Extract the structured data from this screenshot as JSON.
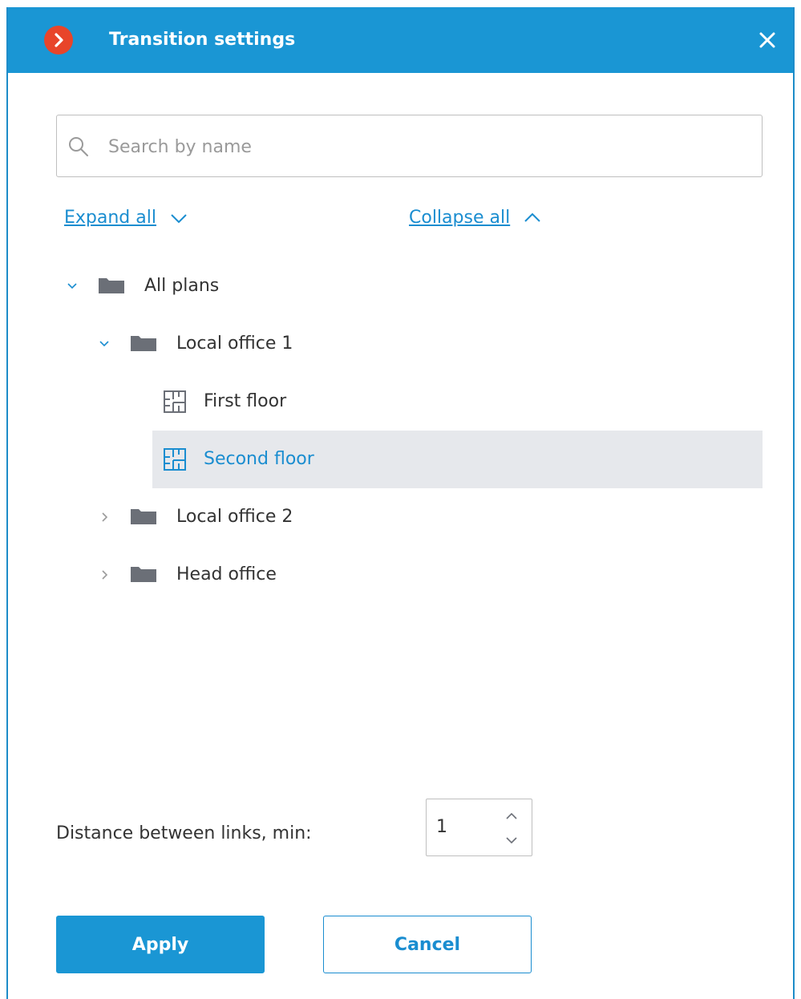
{
  "window": {
    "title": "Transition settings"
  },
  "search": {
    "placeholder": "Search by name",
    "value": ""
  },
  "actions": {
    "expand_all": "Expand all",
    "collapse_all": "Collapse all"
  },
  "tree": {
    "items": [
      {
        "label": "All plans",
        "level": 0,
        "type": "folder",
        "expanded": true
      },
      {
        "label": "Local office 1",
        "level": 1,
        "type": "folder",
        "expanded": true
      },
      {
        "label": "First floor",
        "level": 2,
        "type": "plan",
        "selected": false
      },
      {
        "label": "Second floor",
        "level": 2,
        "type": "plan",
        "selected": true
      },
      {
        "label": "Local office 2",
        "level": 1,
        "type": "folder",
        "expanded": false
      },
      {
        "label": "Head office",
        "level": 1,
        "type": "folder",
        "expanded": false
      }
    ]
  },
  "distance": {
    "label": "Distance between links, min:",
    "value": "1"
  },
  "buttons": {
    "apply": "Apply",
    "cancel": "Cancel"
  },
  "colors": {
    "accent": "#1a96d4",
    "link": "#1a8dd0",
    "logo": "#e8452a",
    "folder": "#6b6f77",
    "selected_row": "#e6e8ec"
  },
  "icons": {
    "logo": "chevron-right-logo-icon",
    "close": "close-icon",
    "search": "search-icon",
    "folder": "folder-icon",
    "plan": "floor-plan-icon"
  }
}
